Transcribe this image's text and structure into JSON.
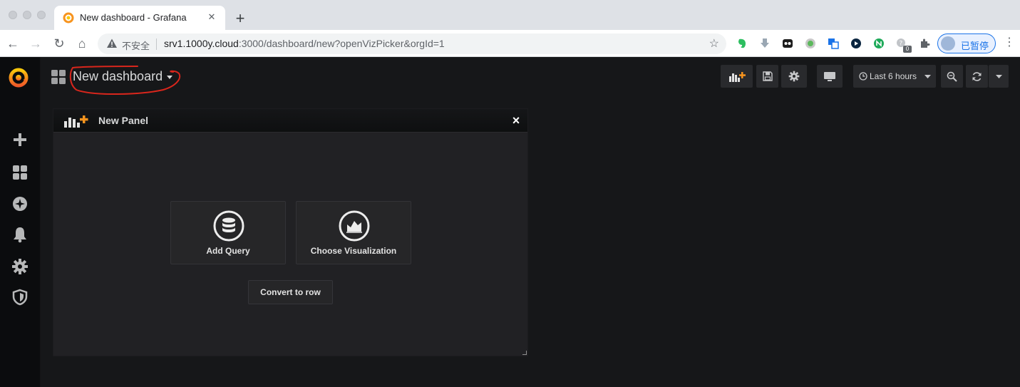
{
  "browser": {
    "tab": {
      "title": "New dashboard - Grafana",
      "close": "✕"
    },
    "new_tab_label": "+",
    "nav": {
      "back": "←",
      "forward": "→",
      "reload": "↻",
      "home": "⌂"
    },
    "address_bar": {
      "security_label": "不安全",
      "url_host": "srv1.1000y.cloud",
      "url_rest": ":3000/dashboard/new?openVizPicker&orgId=1"
    },
    "profile": {
      "label": "已暂停"
    },
    "extension_badge": "0"
  },
  "grafana": {
    "sidemenu": {
      "items": [
        {
          "name": "create-icon"
        },
        {
          "name": "dashboards-icon"
        },
        {
          "name": "explore-icon"
        },
        {
          "name": "alerting-icon"
        },
        {
          "name": "configuration-icon"
        },
        {
          "name": "server-admin-icon"
        }
      ]
    },
    "dashboard": {
      "title": "New dashboard"
    },
    "navbar": {
      "time_picker_label": "Last 6 hours"
    },
    "panel": {
      "title": "New Panel",
      "close": "×",
      "actions": [
        {
          "label": "Add Query",
          "icon": "database-icon"
        },
        {
          "label": "Choose Visualization",
          "icon": "chart-icon"
        }
      ],
      "convert_label": "Convert to row"
    }
  },
  "colors": {
    "grafana_bg": "#161719",
    "sidemenu_bg": "#0b0c0e",
    "panel_bg": "#212124",
    "accent_orange": "#f7941e",
    "annotation_red": "#d9261c"
  }
}
